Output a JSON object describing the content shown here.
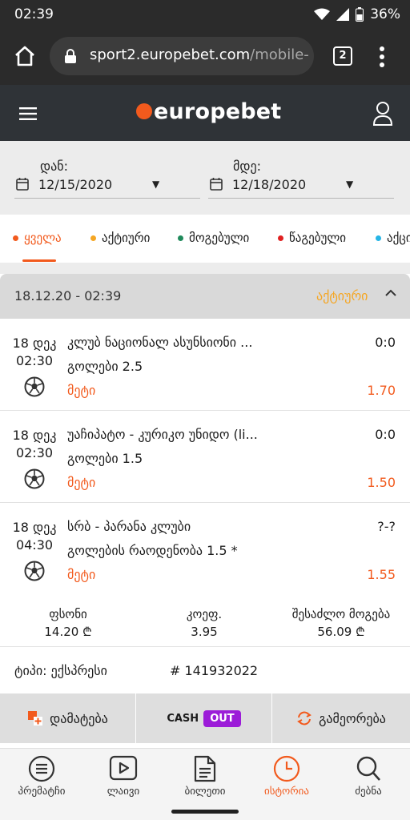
{
  "status_bar": {
    "time": "02:39",
    "battery": "36%"
  },
  "browser": {
    "url_main": "sport2.europebet.com",
    "url_rest": "/mobile-",
    "tab_count": "2"
  },
  "site": {
    "brand": "europebet"
  },
  "date_filter": {
    "from_label": "დან:",
    "from_value": "12/15/2020",
    "to_label": "მდე:",
    "to_value": "12/18/2020"
  },
  "status_tabs": [
    {
      "label": "ყველა",
      "color": "#f25a1d"
    },
    {
      "label": "აქტიური",
      "color": "#f5a623"
    },
    {
      "label": "მოგებული",
      "color": "#1f8a5b"
    },
    {
      "label": "წაგებული",
      "color": "#e02020"
    },
    {
      "label": "აქცი",
      "color": "#26b5e6"
    }
  ],
  "bet": {
    "datetime": "18.12.20 - 02:39",
    "status": "აქტიური",
    "events": [
      {
        "day": "18 დეკ",
        "time": "02:30",
        "name": "კლუბ ნაციონალ ასუნსიონი ...",
        "score": "0:0",
        "market": "გოლები 2.5",
        "pick": "მეტი",
        "odd": "1.70"
      },
      {
        "day": "18 დეკ",
        "time": "02:30",
        "name": "უაჩიპატო - კურიკო უნიდო (li...",
        "score": "0:0",
        "market": "გოლები 1.5",
        "pick": "მეტი",
        "odd": "1.50"
      },
      {
        "day": "18 დეკ",
        "time": "04:30",
        "name": "სრბ - პარანა კლუბი",
        "score": "?-?",
        "market": "გოლების რაოდენობა 1.5 *",
        "pick": "მეტი",
        "odd": "1.55"
      }
    ],
    "stake_label": "ფსონი",
    "stake_value": "14.20 ₾",
    "coef_label": "კოეფ.",
    "coef_value": "3.95",
    "win_label": "შესაძლო მოგება",
    "win_value": "56.09 ₾",
    "type_label": "ტიპი: ექსპრესი",
    "id_label": "# 141932022"
  },
  "actions": {
    "add": "დამატება",
    "cash": "CASH",
    "out": "OUT",
    "repeat": "გამეორება"
  },
  "nav": [
    {
      "label": "პრემატჩი",
      "icon": "list-icon"
    },
    {
      "label": "ლაივი",
      "icon": "play-icon"
    },
    {
      "label": "ბილეთი",
      "icon": "ticket-icon"
    },
    {
      "label": "ისტორია",
      "icon": "clock-icon",
      "active": true
    },
    {
      "label": "ძებნა",
      "icon": "search-icon"
    }
  ],
  "colors": {
    "accent": "#f25a1d",
    "active_status": "#f5a623",
    "cashout": "#9c1cd8"
  }
}
